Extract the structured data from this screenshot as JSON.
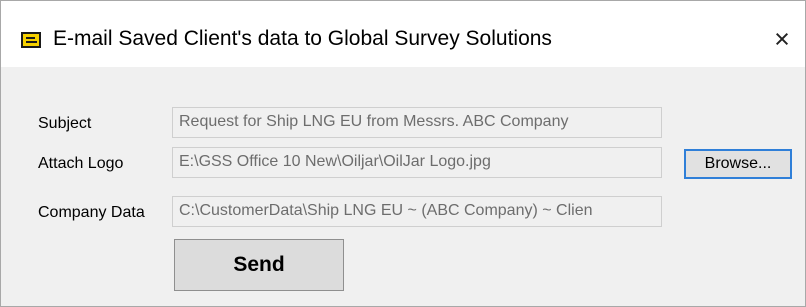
{
  "window": {
    "title": "E-mail Saved Client's data to Global Survey Solutions",
    "icon": "app-envelope-icon",
    "close_glyph": "×"
  },
  "form": {
    "subject_label": "Subject",
    "subject_value": "Request for Ship LNG EU from Messrs. ABC Company",
    "logo_label": "Attach Logo",
    "logo_value": "E:\\GSS Office 10 New\\Oiljar\\OilJar Logo.jpg",
    "browse_label": "Browse...",
    "company_label": "Company Data",
    "company_value": "C:\\CustomerData\\Ship LNG EU ~ (ABC Company) ~ Clien",
    "send_label": "Send"
  },
  "colors": {
    "accent": "#2f7fd8",
    "icon_yellow": "#f5d000"
  }
}
